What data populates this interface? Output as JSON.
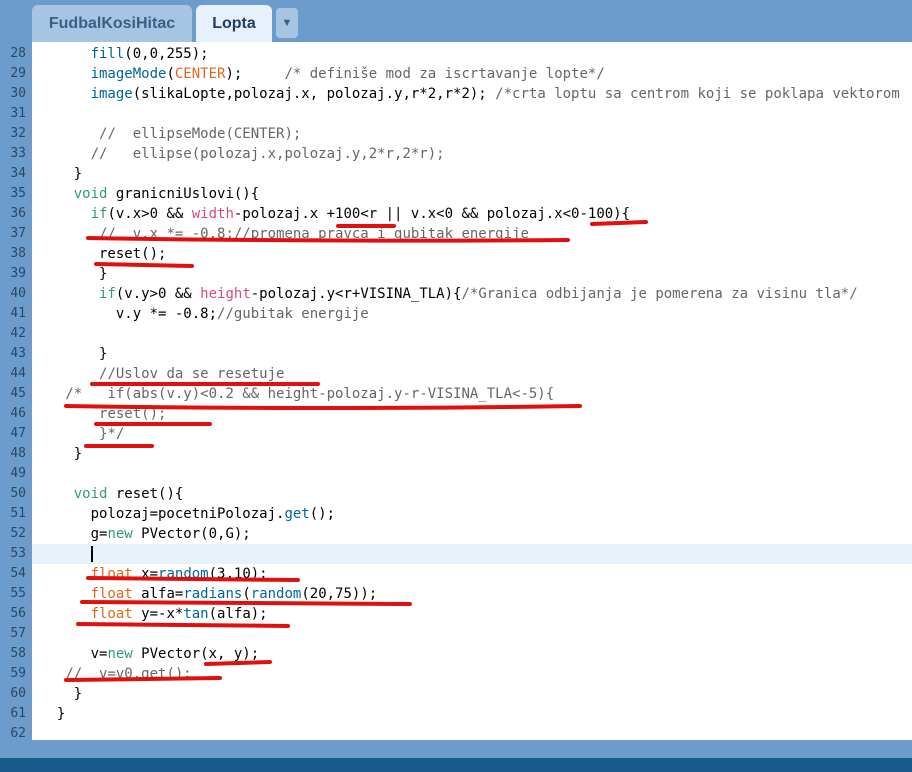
{
  "tabs": [
    {
      "label": "FudbalKosiHitac",
      "active": false
    },
    {
      "label": "Lopta",
      "active": true
    }
  ],
  "tab_menu_icon": "chevron-down-icon",
  "editor": {
    "current_line": "53",
    "lines": [
      {
        "n": "28",
        "segs": [
          [
            "      ",
            ""
          ],
          [
            "fill",
            "fn"
          ],
          [
            "(0,0,255);",
            ""
          ]
        ]
      },
      {
        "n": "29",
        "segs": [
          [
            "      ",
            ""
          ],
          [
            "imageMode",
            "fn"
          ],
          [
            "(",
            ""
          ],
          [
            "CENTER",
            "c2"
          ],
          [
            ");     ",
            ""
          ],
          [
            "/* definiše mod za iscrtavanje lopte*/",
            "cm"
          ]
        ]
      },
      {
        "n": "30",
        "segs": [
          [
            "      ",
            ""
          ],
          [
            "image",
            "fn"
          ],
          [
            "(slikaLopte,polozaj.x, polozaj.y,r*2,r*2); ",
            ""
          ],
          [
            "/*crta loptu sa centrom koji se poklapa vektorom",
            "cm"
          ]
        ]
      },
      {
        "n": "31",
        "segs": []
      },
      {
        "n": "32",
        "segs": [
          [
            "       ",
            ""
          ],
          [
            "//  ellipseMode(CENTER);",
            "cm"
          ]
        ]
      },
      {
        "n": "33",
        "segs": [
          [
            "      ",
            ""
          ],
          [
            "//   ellipse(polozaj.x,polozaj.y,2*r,2*r);",
            "cm"
          ]
        ]
      },
      {
        "n": "34",
        "segs": [
          [
            "    }",
            ""
          ]
        ]
      },
      {
        "n": "35",
        "segs": [
          [
            "    ",
            ""
          ],
          [
            "void",
            "kw"
          ],
          [
            " granicniUslovi(){",
            ""
          ]
        ]
      },
      {
        "n": "36",
        "segs": [
          [
            "      ",
            ""
          ],
          [
            "if",
            "kw"
          ],
          [
            "(v.x>0 && ",
            ""
          ],
          [
            "width",
            "c3"
          ],
          [
            "-polozaj.x +100<r || v.x<0 && polozaj.x<0-100){",
            ""
          ]
        ]
      },
      {
        "n": "37",
        "segs": [
          [
            "       ",
            ""
          ],
          [
            "//  v.x *= -0.8;//promena pravca i gubitak energije",
            "cm"
          ]
        ]
      },
      {
        "n": "38",
        "segs": [
          [
            "       reset();",
            ""
          ]
        ]
      },
      {
        "n": "39",
        "segs": [
          [
            "       }",
            ""
          ]
        ]
      },
      {
        "n": "40",
        "segs": [
          [
            "       ",
            ""
          ],
          [
            "if",
            "kw"
          ],
          [
            "(v.y>0 && ",
            ""
          ],
          [
            "height",
            "c3"
          ],
          [
            "-polozaj.y<r+VISINA_TLA){",
            ""
          ],
          [
            "/*Granica odbijanja je pomerena za visinu tla*/",
            "cm"
          ]
        ]
      },
      {
        "n": "41",
        "segs": [
          [
            "         v.y *= -0.8;",
            ""
          ],
          [
            "//gubitak energije",
            "cm"
          ]
        ]
      },
      {
        "n": "42",
        "segs": []
      },
      {
        "n": "43",
        "segs": [
          [
            "       }",
            ""
          ]
        ]
      },
      {
        "n": "44",
        "segs": [
          [
            "       ",
            ""
          ],
          [
            "//Uslov da se resetuje",
            "cm"
          ]
        ]
      },
      {
        "n": "45",
        "segs": [
          [
            "   ",
            ""
          ],
          [
            "/*   if(abs(v.y)<0.2 && height-polozaj.y-r-VISINA_TLA<-5){",
            "cm"
          ]
        ]
      },
      {
        "n": "46",
        "segs": [
          [
            "       ",
            ""
          ],
          [
            "reset();",
            "cm"
          ]
        ]
      },
      {
        "n": "47",
        "segs": [
          [
            "       ",
            ""
          ],
          [
            "}*/",
            "cm"
          ]
        ]
      },
      {
        "n": "48",
        "segs": [
          [
            "    }",
            ""
          ]
        ]
      },
      {
        "n": "49",
        "segs": []
      },
      {
        "n": "50",
        "segs": [
          [
            "    ",
            ""
          ],
          [
            "void",
            "kw"
          ],
          [
            " reset(){",
            ""
          ]
        ]
      },
      {
        "n": "51",
        "segs": [
          [
            "      polozaj=pocetniPolozaj.",
            ""
          ],
          [
            "get",
            "fn"
          ],
          [
            "();",
            ""
          ]
        ]
      },
      {
        "n": "52",
        "segs": [
          [
            "      g=",
            ""
          ],
          [
            "new",
            "kw"
          ],
          [
            " PVector(0,G);",
            ""
          ]
        ]
      },
      {
        "n": "53",
        "segs": [
          [
            "      ",
            ""
          ]
        ],
        "cursor": true
      },
      {
        "n": "54",
        "segs": [
          [
            "      ",
            ""
          ],
          [
            "float",
            "c2"
          ],
          [
            " x=",
            ""
          ],
          [
            "random",
            "fn"
          ],
          [
            "(3,10);",
            ""
          ]
        ]
      },
      {
        "n": "55",
        "segs": [
          [
            "      ",
            ""
          ],
          [
            "float",
            "c2"
          ],
          [
            " alfa=",
            ""
          ],
          [
            "radians",
            "fn"
          ],
          [
            "(",
            ""
          ],
          [
            "random",
            "fn"
          ],
          [
            "(20,75));",
            ""
          ]
        ]
      },
      {
        "n": "56",
        "segs": [
          [
            "      ",
            ""
          ],
          [
            "float",
            "c2"
          ],
          [
            " y=-x*",
            ""
          ],
          [
            "tan",
            "fn"
          ],
          [
            "(alfa);",
            ""
          ]
        ]
      },
      {
        "n": "57",
        "segs": []
      },
      {
        "n": "58",
        "segs": [
          [
            "      v=",
            ""
          ],
          [
            "new",
            "kw"
          ],
          [
            " PVector(x, y);",
            ""
          ]
        ]
      },
      {
        "n": "59",
        "segs": [
          [
            "   ",
            ""
          ],
          [
            "//  v=v0.get();",
            "cm"
          ]
        ]
      },
      {
        "n": "60",
        "segs": [
          [
            "    }",
            ""
          ]
        ]
      },
      {
        "n": "61",
        "segs": [
          [
            "  }",
            ""
          ]
        ]
      },
      {
        "n": "62",
        "segs": []
      }
    ]
  },
  "colors": {
    "background": "#6c9ccc",
    "annotation_underline": "#e01010",
    "keyword": "#33997e",
    "function": "#006699",
    "comment": "#666666",
    "type": "#e2661a",
    "builtin_var": "#d94a7a"
  }
}
